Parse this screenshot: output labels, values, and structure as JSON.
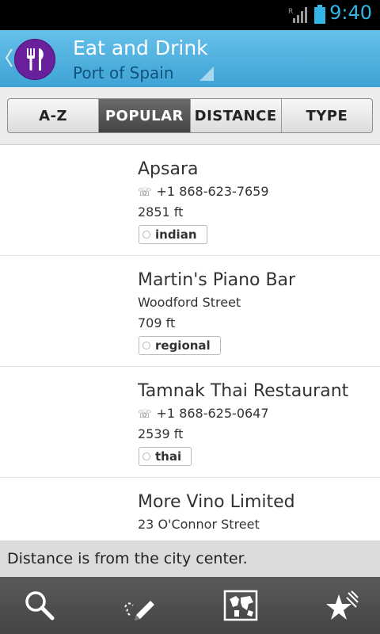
{
  "status_bar": {
    "time": "9:40",
    "roaming": "R"
  },
  "action_bar": {
    "title": "Eat and Drink",
    "subtitle": "Port of Spain",
    "accent": "#3ea3d5",
    "icon_color": "#6a1f9d"
  },
  "tabs": [
    {
      "label": "A-Z",
      "active": false
    },
    {
      "label": "POPULAR",
      "active": true
    },
    {
      "label": "DISTANCE",
      "active": false
    },
    {
      "label": "TYPE",
      "active": false
    }
  ],
  "places": [
    {
      "name": "Apsara",
      "detail": "+1 868-623-7659",
      "detail_icon": "phone-icon",
      "distance": "2851 ft",
      "tag": "indian"
    },
    {
      "name": "Martin's Piano Bar",
      "detail": "Woodford Street",
      "detail_icon": "",
      "distance": "709 ft",
      "tag": "regional"
    },
    {
      "name": "Tamnak Thai Restaurant",
      "detail": "+1 868-625-0647",
      "detail_icon": "phone-icon",
      "distance": "2539 ft",
      "tag": "thai"
    },
    {
      "name": "More Vino Limited",
      "detail": "23 O'Connor Street",
      "detail_icon": "",
      "distance": "",
      "tag": ""
    }
  ],
  "info_text": "Distance is from the city center.",
  "bottom_nav": [
    {
      "icon": "search-icon"
    },
    {
      "icon": "pencil-icon"
    },
    {
      "icon": "map-icon"
    },
    {
      "icon": "stars-icon"
    }
  ]
}
